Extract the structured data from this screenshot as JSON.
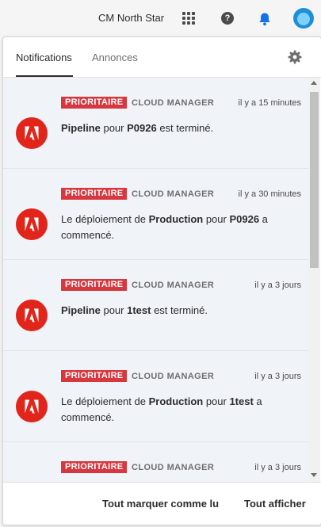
{
  "header": {
    "org_name": "CM North Star",
    "icons": [
      "apps-grid-icon",
      "help-icon",
      "bell-icon",
      "user-avatar"
    ],
    "bell_color": "#1473e6"
  },
  "panel": {
    "tabs": [
      {
        "label": "Notifications",
        "active": true
      },
      {
        "label": "Annonces",
        "active": false
      }
    ],
    "settings_icon": "gear-icon"
  },
  "notifications": [
    {
      "badge": "PRIORITAIRE",
      "source": "CLOUD MANAGER",
      "time": "il y a 15 minutes",
      "message_parts": [
        {
          "text": "Pipeline",
          "bold": true
        },
        {
          "text": " pour ",
          "bold": false
        },
        {
          "text": "P0926",
          "bold": true
        },
        {
          "text": " est terminé.",
          "bold": false
        }
      ]
    },
    {
      "badge": "PRIORITAIRE",
      "source": "CLOUD MANAGER",
      "time": "il y a 30 minutes",
      "message_parts": [
        {
          "text": "Le déploiement de ",
          "bold": false
        },
        {
          "text": "Production",
          "bold": true
        },
        {
          "text": " pour ",
          "bold": false
        },
        {
          "text": "P0926",
          "bold": true
        },
        {
          "text": " a commencé.",
          "bold": false
        }
      ]
    },
    {
      "badge": "PRIORITAIRE",
      "source": "CLOUD MANAGER",
      "time": "il y a 3 jours",
      "message_parts": [
        {
          "text": "Pipeline",
          "bold": true
        },
        {
          "text": " pour ",
          "bold": false
        },
        {
          "text": "1test",
          "bold": true
        },
        {
          "text": " est terminé.",
          "bold": false
        }
      ]
    },
    {
      "badge": "PRIORITAIRE",
      "source": "CLOUD MANAGER",
      "time": "il y a 3 jours",
      "message_parts": [
        {
          "text": "Le déploiement de ",
          "bold": false
        },
        {
          "text": "Production",
          "bold": true
        },
        {
          "text": " pour ",
          "bold": false
        },
        {
          "text": "1test",
          "bold": true
        },
        {
          "text": " a commencé.",
          "bold": false
        }
      ]
    },
    {
      "badge": "PRIORITAIRE",
      "source": "CLOUD MANAGER",
      "time": "il y a 3 jours",
      "message_parts": []
    }
  ],
  "footer": {
    "mark_all_read": "Tout marquer comme lu",
    "show_all": "Tout afficher"
  },
  "colors": {
    "badge_bg": "#d7373f",
    "logo_bg": "#e1251b",
    "list_bg": "#f0f3f8"
  }
}
